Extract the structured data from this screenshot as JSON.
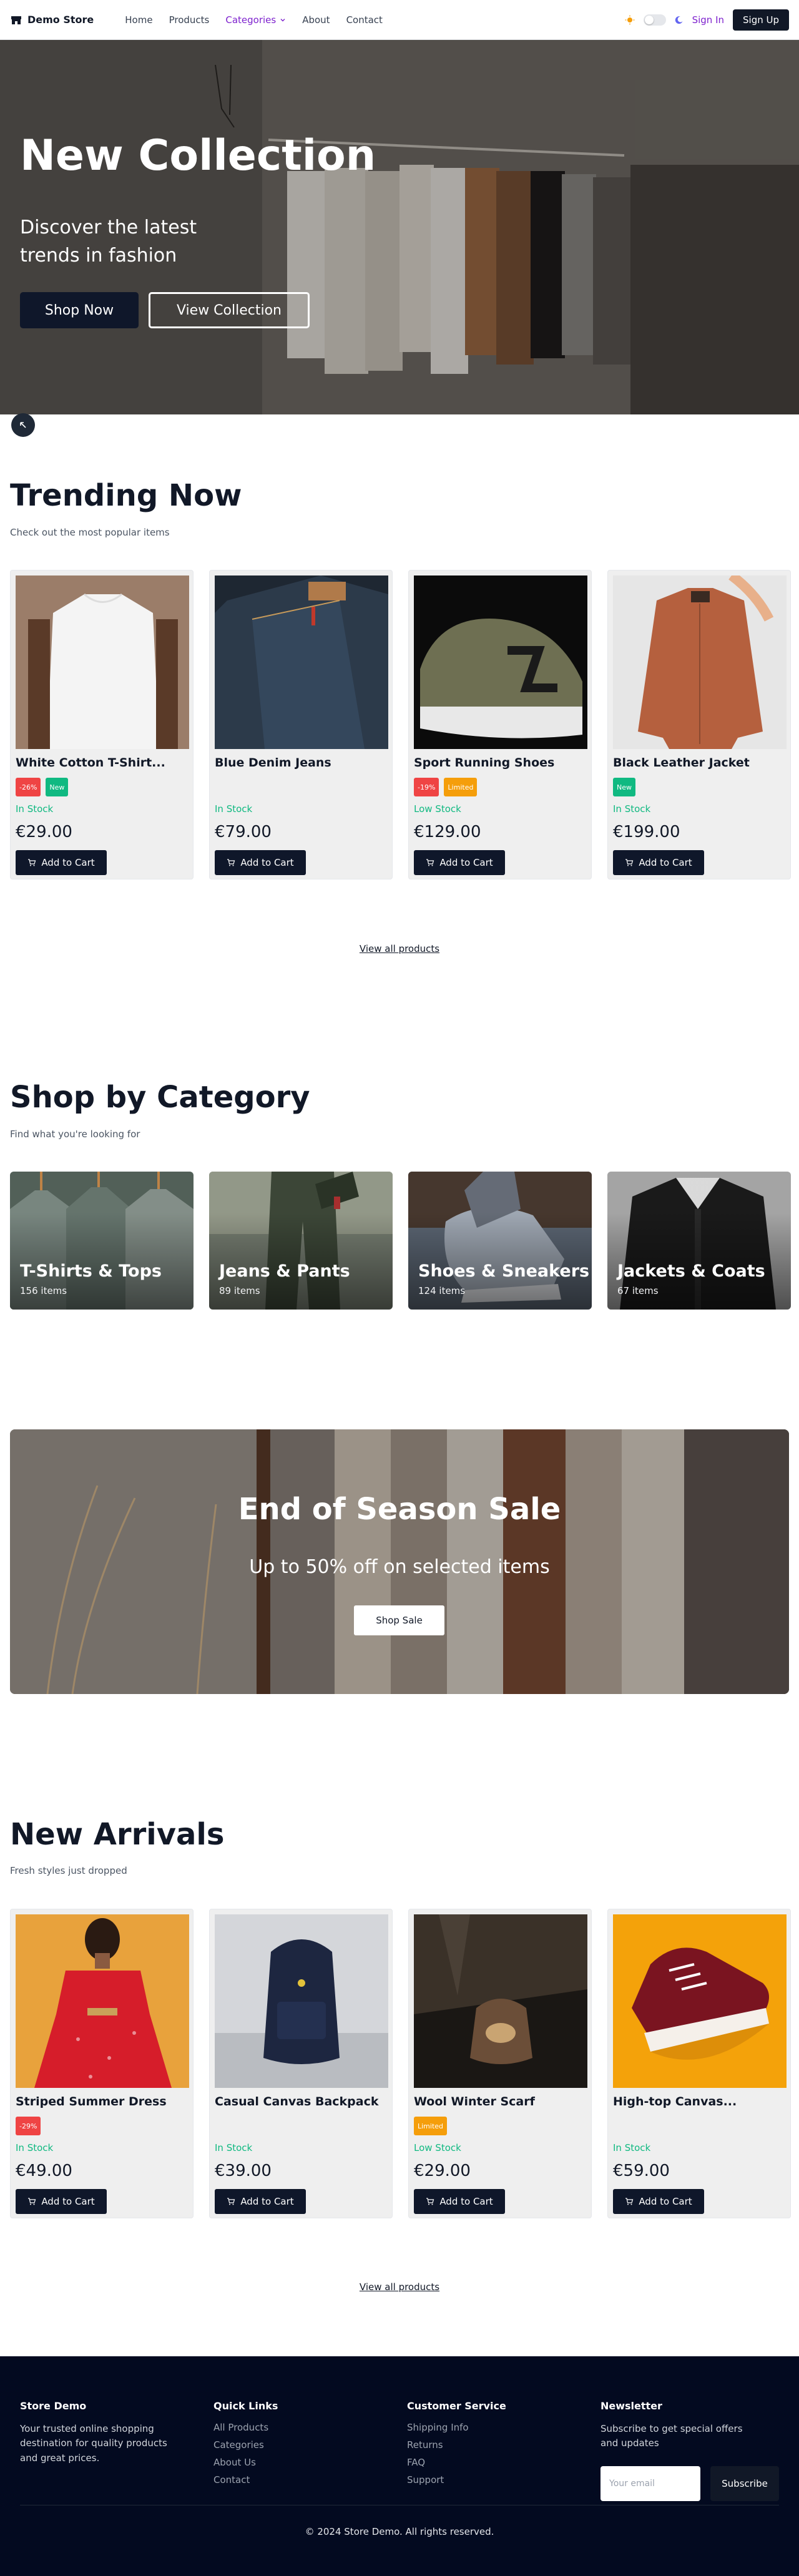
{
  "nav": {
    "brand": "Demo Store",
    "links": [
      "Home",
      "Products",
      "Categories",
      "About",
      "Contact"
    ],
    "sign_in": "Sign In",
    "sign_up": "Sign Up"
  },
  "hero": {
    "title": "New Collection",
    "subtitle": "Discover the latest trends in fashion",
    "primary_button": "Shop Now",
    "secondary_button": "View Collection"
  },
  "trending": {
    "title": "Trending Now",
    "subtitle": "Check out the most popular items",
    "view_all": "View all products",
    "products": [
      {
        "name": "White Cotton T-Shirt...",
        "badges": [
          {
            "text": "-26%",
            "color": "#ef4444"
          },
          {
            "text": "New",
            "color": "#10b981"
          }
        ],
        "stock": "In Stock",
        "price": "€29.00",
        "cart": "Add to Cart"
      },
      {
        "name": "Blue Denim Jeans",
        "badges": [],
        "stock": "In Stock",
        "price": "€79.00",
        "cart": "Add to Cart"
      },
      {
        "name": "Sport Running Shoes",
        "badges": [
          {
            "text": "-19%",
            "color": "#ef4444"
          },
          {
            "text": "Limited",
            "color": "#f59e0b"
          }
        ],
        "stock": "Low Stock",
        "price": "€129.00",
        "cart": "Add to Cart"
      },
      {
        "name": "Black Leather Jacket",
        "badges": [
          {
            "text": "New",
            "color": "#10b981"
          }
        ],
        "stock": "In Stock",
        "price": "€199.00",
        "cart": "Add to Cart"
      }
    ]
  },
  "categories": {
    "title": "Shop by Category",
    "subtitle": "Find what you're looking for",
    "items": [
      {
        "name": "T-Shirts & Tops",
        "count": "156 items"
      },
      {
        "name": "Jeans & Pants",
        "count": "89 items"
      },
      {
        "name": "Shoes & Sneakers",
        "count": "124 items"
      },
      {
        "name": "Jackets & Coats",
        "count": "67 items"
      }
    ]
  },
  "sale": {
    "title": "End of Season Sale",
    "subtitle": "Up to 50% off on selected items",
    "button": "Shop Sale"
  },
  "arrivals": {
    "title": "New Arrivals",
    "subtitle": "Fresh styles just dropped",
    "view_all": "View all products",
    "products": [
      {
        "name": "Striped Summer Dress",
        "badges": [
          {
            "text": "-29%",
            "color": "#ef4444"
          }
        ],
        "stock": "In Stock",
        "price": "€49.00",
        "cart": "Add to Cart"
      },
      {
        "name": "Casual Canvas Backpack",
        "badges": [],
        "stock": "In Stock",
        "price": "€39.00",
        "cart": "Add to Cart"
      },
      {
        "name": "Wool Winter Scarf",
        "badges": [
          {
            "text": "Limited",
            "color": "#f59e0b"
          }
        ],
        "stock": "Low Stock",
        "price": "€29.00",
        "cart": "Add to Cart"
      },
      {
        "name": "High-top Canvas...",
        "badges": [],
        "stock": "In Stock",
        "price": "€59.00",
        "cart": "Add to Cart"
      }
    ]
  },
  "footer": {
    "about_title": "Store Demo",
    "about_text": "Your trusted online shopping destination for quality products and great prices.",
    "quick_title": "Quick Links",
    "quick_links": [
      "All Products",
      "Categories",
      "About Us",
      "Contact"
    ],
    "service_title": "Customer Service",
    "service_links": [
      "Shipping Info",
      "Returns",
      "FAQ",
      "Support"
    ],
    "newsletter_title": "Newsletter",
    "newsletter_text": "Subscribe to get special offers and updates",
    "email_placeholder": "Your email",
    "subscribe": "Subscribe",
    "copyright": "© 2024 Store Demo. All rights reserved."
  },
  "colors": {
    "accent": "#7e22ce",
    "dark": "#0f172a",
    "in_stock": "#10b981",
    "footer_bg": "#030a20"
  }
}
